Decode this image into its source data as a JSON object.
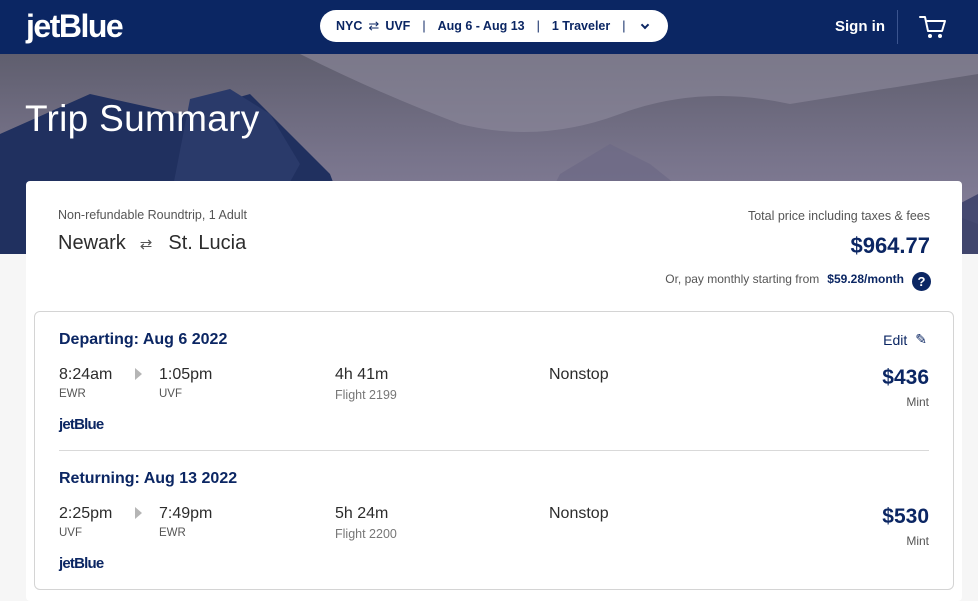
{
  "header": {
    "logo_text": "jetBlue",
    "search": {
      "origin": "NYC",
      "swap_glyph": "⇄",
      "destination": "UVF",
      "dates": "Aug 6 - Aug 13",
      "travelers": "1 Traveler"
    },
    "sign_in_label": "Sign in",
    "cart_icon": "cart-icon"
  },
  "hero": {
    "title": "Trip Summary"
  },
  "summary": {
    "trip_type": "Non-refundable Roundtrip, 1 Adult",
    "origin_city": "Newark",
    "swap_glyph": "⇄",
    "destination_city": "St. Lucia",
    "total_label": "Total price including taxes & fees",
    "total_price": "$964.77",
    "monthly_text": "Or, pay monthly starting from",
    "monthly_amount": "$59.28/month",
    "help_glyph": "?"
  },
  "legs": [
    {
      "title": "Departing: Aug 6 2022",
      "edit_label": "Edit",
      "depart_time": "8:24am",
      "depart_code": "EWR",
      "arrive_time": "1:05pm",
      "arrive_code": "UVF",
      "duration": "4h 41m",
      "flight_number": "Flight 2199",
      "stops": "Nonstop",
      "price": "$436",
      "cabin": "Mint",
      "airline": "jetBlue"
    },
    {
      "title": "Returning: Aug 13 2022",
      "depart_time": "2:25pm",
      "depart_code": "UVF",
      "arrive_time": "7:49pm",
      "arrive_code": "EWR",
      "duration": "5h 24m",
      "flight_number": "Flight 2200",
      "stops": "Nonstop",
      "price": "$530",
      "cabin": "Mint",
      "airline": "jetBlue"
    }
  ],
  "colors": {
    "brand_navy": "#0b2663",
    "background": "#f6f6f6"
  }
}
